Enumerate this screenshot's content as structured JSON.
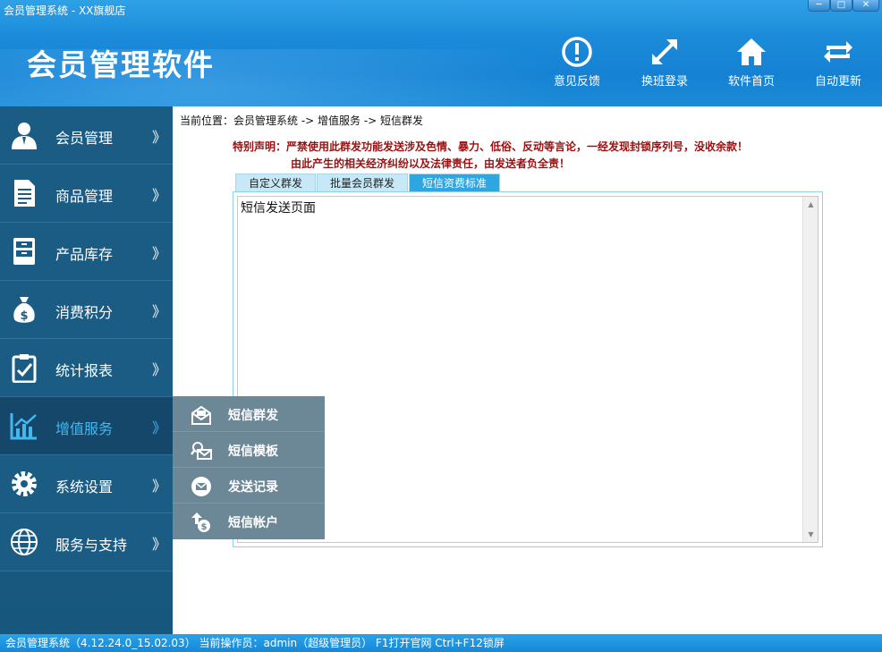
{
  "window": {
    "title": "会员管理系统 - XX旗舰店",
    "controls": [
      "─",
      "□",
      "✕"
    ]
  },
  "header": {
    "app_title": "会员管理软件",
    "tools": [
      {
        "label": "意见反馈",
        "icon": "feedback-icon"
      },
      {
        "label": "换班登录",
        "icon": "switch-login-icon"
      },
      {
        "label": "软件首页",
        "icon": "home-icon"
      },
      {
        "label": "自动更新",
        "icon": "auto-update-icon"
      }
    ]
  },
  "sidebar": {
    "items": [
      {
        "label": "会员管理",
        "arrow": "》",
        "icon": "member-icon"
      },
      {
        "label": "商品管理",
        "arrow": "》",
        "icon": "document-icon"
      },
      {
        "label": "产品库存",
        "arrow": "》",
        "icon": "cabinet-icon"
      },
      {
        "label": "消费积分",
        "arrow": "》",
        "icon": "money-bag-icon"
      },
      {
        "label": "统计报表",
        "arrow": "》",
        "icon": "clipboard-check-icon"
      },
      {
        "label": "增值服务",
        "arrow": "》",
        "icon": "chart-icon",
        "active": true
      },
      {
        "label": "系统设置",
        "arrow": "》",
        "icon": "gear-icon"
      },
      {
        "label": "服务与支持",
        "arrow": "》",
        "icon": "globe-icon"
      }
    ]
  },
  "submenu": {
    "items": [
      {
        "label": "短信群发",
        "icon": "envelope-open-icon"
      },
      {
        "label": "短信模板",
        "icon": "envelope-search-icon"
      },
      {
        "label": "发送记录",
        "icon": "mail-record-icon"
      },
      {
        "label": "短信帐户",
        "icon": "account-money-icon"
      }
    ]
  },
  "main": {
    "breadcrumb": "当前位置：会员管理系统 -> 增值服务 -> 短信群发",
    "notice_line1": "特别声明：严禁使用此群发功能发送涉及色情、暴力、低俗、反动等言论，一经发现封锁序列号，没收余款！",
    "notice_line2": "由此产生的相关经济纠纷以及法律责任，由发送者负全责！",
    "tabs": [
      {
        "label": "自定义群发",
        "active": false
      },
      {
        "label": "批量会员群发",
        "active": false
      },
      {
        "label": "短信资费标准",
        "active": true
      }
    ],
    "content_text": "短信发送页面"
  },
  "statusbar": {
    "text": "会员管理系统（4.12.24.0_15.02.03） 当前操作员：admin（超级管理员） F1打开官网 Ctrl+F12锁屏"
  },
  "colors": {
    "header_blue": "#1b8bd9",
    "sidebar_bg": "#1a5c84",
    "active_text": "#44b8ee",
    "submenu_bg": "#6c8796",
    "notice_red": "#9a1010",
    "tab_active": "#2ea6e2"
  }
}
